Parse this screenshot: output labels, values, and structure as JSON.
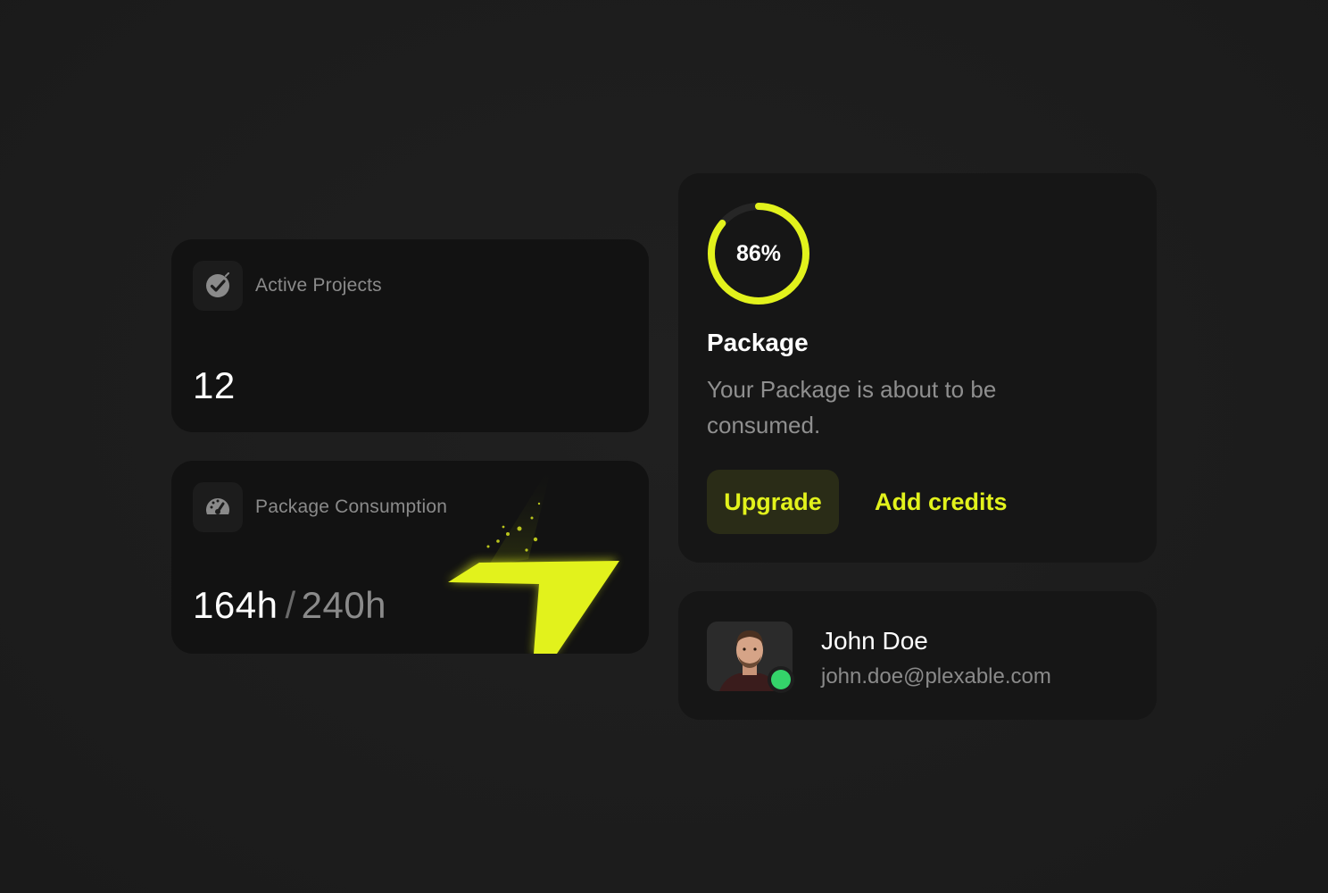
{
  "colors": {
    "accent": "#e2f21c",
    "background": "#1e1e1e",
    "card": "#121212",
    "online": "#34d36a"
  },
  "active_projects": {
    "icon": "check-circle-icon",
    "label": "Active Projects",
    "value": "12"
  },
  "package_consumption": {
    "icon": "speedometer-icon",
    "label": "Package Consumption",
    "used": "164h",
    "separator": "/",
    "total": "240h",
    "decoration": "lightning-bolt-icon"
  },
  "package": {
    "progress_percent": 86,
    "progress_label": "86%",
    "title": "Package",
    "description": "Your Package is about to be consumed.",
    "upgrade_label": "Upgrade",
    "add_credits_label": "Add credits"
  },
  "user": {
    "name": "John Doe",
    "email": "john.doe@plexable.com",
    "status": "online"
  }
}
